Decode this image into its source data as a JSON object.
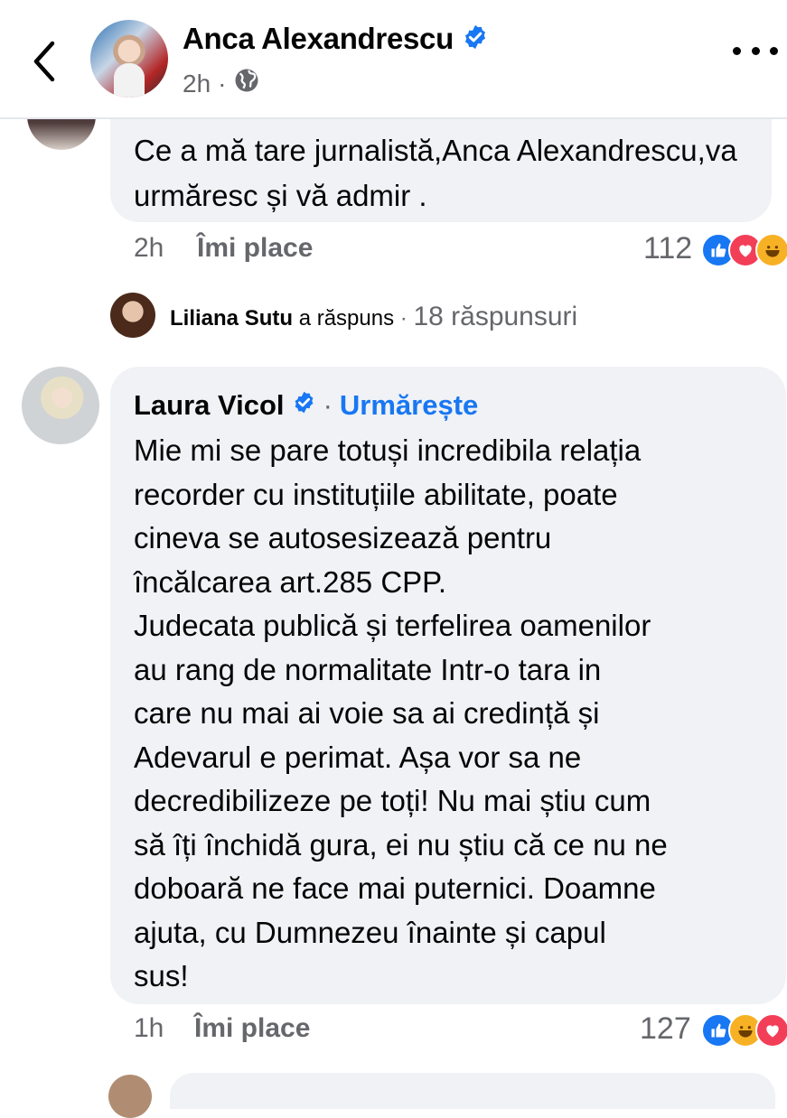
{
  "header": {
    "page_name": "Anca Alexandrescu",
    "time": "2h",
    "separator": "·",
    "privacy_icon": "globe-icon"
  },
  "comment1": {
    "text": "Ce a mă tare jurnalistă,Anca Alexandrescu,va urmăresc și vă admir .",
    "time": "2h",
    "like_label": "Îmi place",
    "reaction_count": "112",
    "reactions": [
      "like",
      "love",
      "haha"
    ]
  },
  "reply_summary": {
    "name": "Liliana Sutu",
    "action": "a răspuns",
    "separator": "·",
    "count": "18 răspunsuri"
  },
  "comment2": {
    "author": "Laura Vicol",
    "separator": "·",
    "follow_label": "Urmărește",
    "text": "Mie mi se pare totuși incredibila relația\nrecorder cu instituțiile abilitate, poate\ncineva se autosesizează pentru\nîncălcarea art.285 CPP.\nJudecata publică și terfelirea oamenilor\nau rang de normalitate Intr-o tara in\ncare nu mai ai voie sa ai credință și\nAdevarul e perimat. Așa vor sa ne\ndecredibilizeze pe toți! Nu mai știu cum\nsă îți închidă gura, ei nu știu că ce nu ne\ndoboară ne face mai puternici. Doamne\najuta, cu Dumnezeu înainte și capul\nsus!",
    "time": "1h",
    "like_label": "Îmi place",
    "reaction_count": "127",
    "reactions": [
      "like",
      "haha",
      "love"
    ]
  },
  "colors": {
    "accent": "#1877f2",
    "bubble": "#f0f2f5",
    "secondary_text": "#65676b"
  }
}
